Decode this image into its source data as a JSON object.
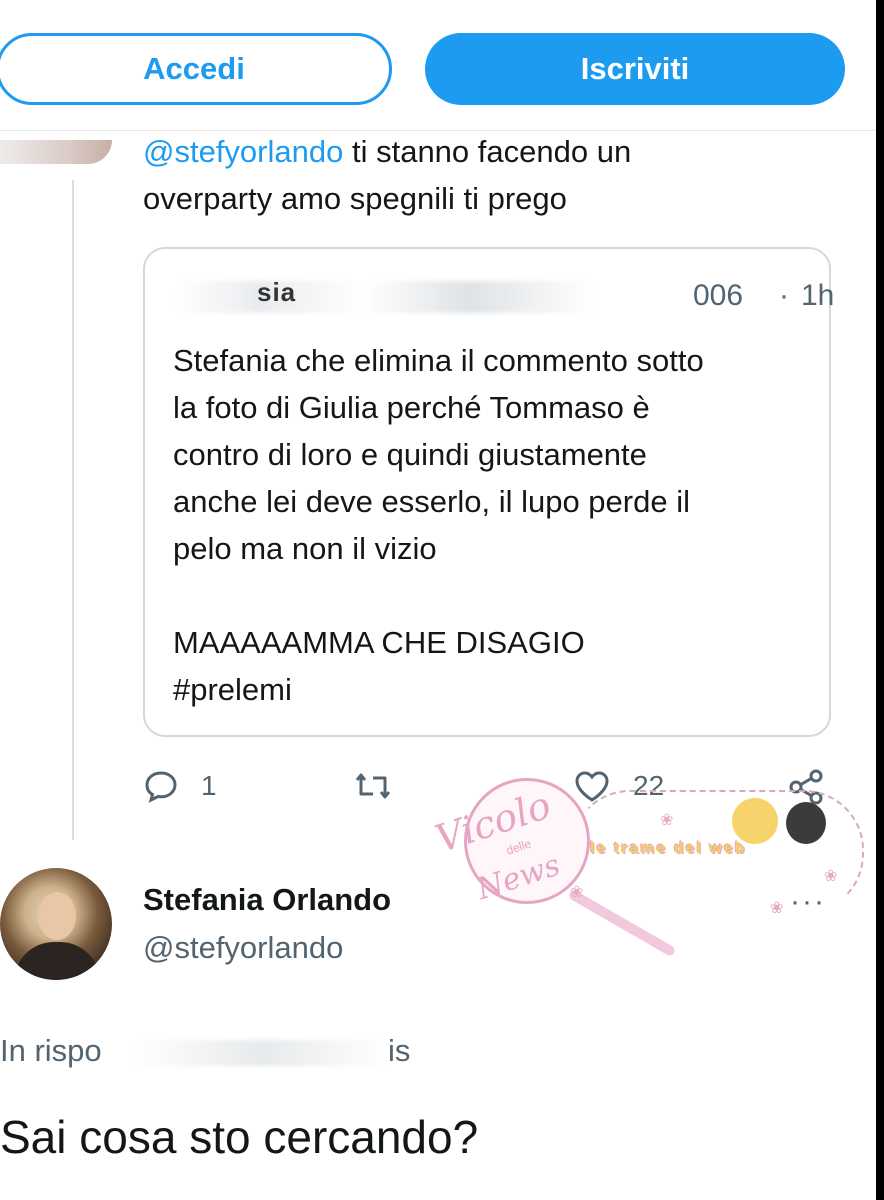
{
  "topbar": {
    "login_label": "Accedi",
    "signup_label": "Iscriviti",
    "accent_color": "#1d9bf0"
  },
  "reply_tweet": {
    "mention": "@stefyorlando",
    "text_line1": " ti stanno facendo un",
    "text_line2": "overparty amo spegnili ti prego"
  },
  "quoted_tweet": {
    "name_fragment": "sia",
    "handle_fragment": "006",
    "separator": "·",
    "time": "1h",
    "body": "Stefania che elimina il commento sotto\nla foto di Giulia perché Tommaso è\ncontro di loro e quindi giustamente\nanche lei deve esserlo, il lupo perde il\npelo ma non il vizio\n\nMAAAAAMMA CHE DISAGIO\n#prelemi"
  },
  "actions": {
    "reply_icon": "reply-icon",
    "reply_count": "1",
    "retweet_icon": "retweet-icon",
    "like_icon": "heart-icon",
    "like_count": "22",
    "share_icon": "share-icon"
  },
  "main_tweet": {
    "author_name": "Stefania Orlando",
    "author_handle": "@stefyorlando",
    "more_icon": "···",
    "reply_to_prefix": "In rispo",
    "reply_to_fragment": "is",
    "text": "Sai cosa sto cercando?"
  },
  "watermark": {
    "logo_line1": "Vicolo",
    "logo_line2": "delle",
    "logo_line3": "News",
    "tagline": "le trame del web"
  }
}
